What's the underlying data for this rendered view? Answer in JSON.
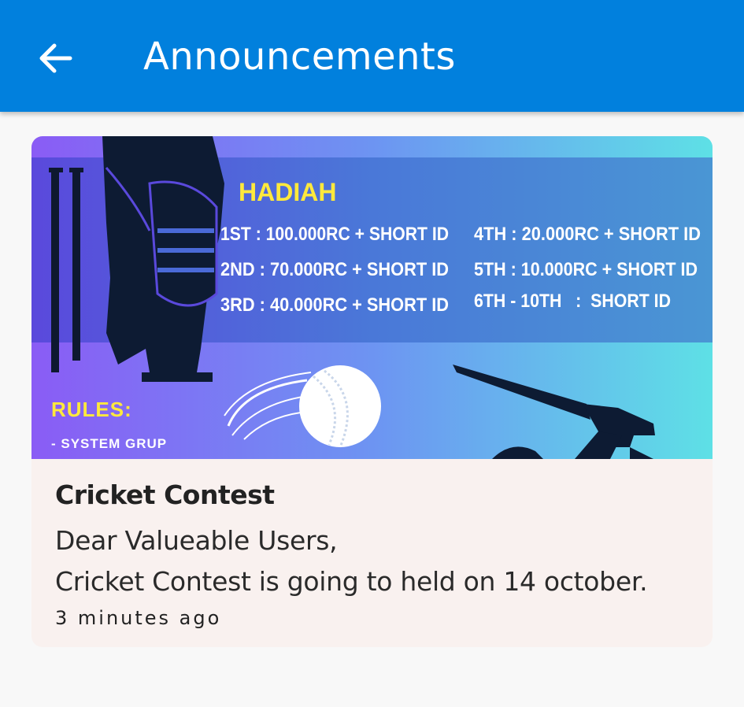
{
  "appbar": {
    "title": "Announcements",
    "back_icon": "arrow-left-icon",
    "color": "#0180dd"
  },
  "announcement": {
    "banner": {
      "heading": "HADIAH",
      "prizes_left": [
        "1ST : 100.000RC + SHORT ID",
        "2ND : 70.000RC + SHORT ID",
        "3RD : 40.000RC + SHORT ID"
      ],
      "prizes_right": [
        "4TH : 20.000RC + SHORT ID",
        "5TH : 10.000RC + SHORT ID",
        "6TH - 10TH   :  SHORT ID"
      ],
      "rules_label": "RULES:",
      "rules_item": "- SYSTEM GRUP",
      "icons": [
        "batsman-icon",
        "cricket-ball-icon",
        "cricket-bat-icon",
        "wicket-icon"
      ]
    },
    "title": "Cricket Contest",
    "message_line1": "Dear Valueable Users,",
    "message_line2": "Cricket Contest is going to held on 14 october.",
    "time": "3 minutes ago"
  }
}
